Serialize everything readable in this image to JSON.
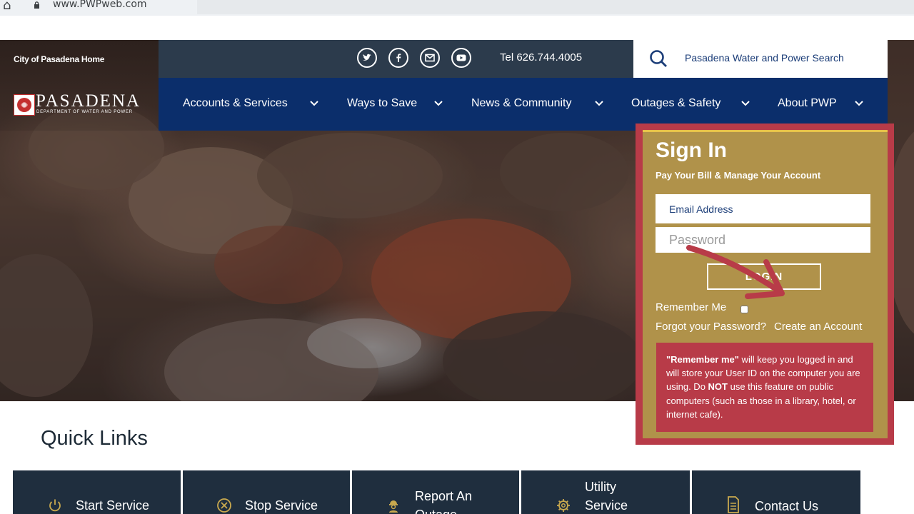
{
  "browser": {
    "url": "www.PWPweb.com",
    "icons": [
      "home-icon",
      "lock-icon"
    ]
  },
  "header": {
    "city_home": "City of Pasadena Home",
    "logo_name": "PASADENA",
    "logo_sub": "DEPARTMENT OF WATER AND POWER",
    "social_icons": [
      "twitter-icon",
      "facebook-icon",
      "email-icon",
      "youtube-icon"
    ],
    "tel": "Tel 626.744.4005",
    "search_label": "Pasadena Water and Power Search"
  },
  "nav": {
    "items": [
      {
        "label": "Accounts & Services"
      },
      {
        "label": "Ways to Save"
      },
      {
        "label": "News & Community"
      },
      {
        "label": "Outages & Safety"
      },
      {
        "label": "About PWP"
      }
    ]
  },
  "signin": {
    "title": "Sign In",
    "subtitle": "Pay Your Bill & Manage Your Account",
    "email_placeholder": "Email Address",
    "password_placeholder": "Password",
    "login_label": "LOGIN",
    "remember_label": "Remember Me",
    "forgot_label": "Forgot your Password?",
    "create_label": "Create an Account",
    "notice": {
      "lead": "\"Remember me\"",
      "part1": " will keep you logged in and will store your User ID on the computer you are using. Do ",
      "emphasis": "NOT",
      "part2": " use this feature on public computers (such as those in a library, hotel, or internet cafe)."
    }
  },
  "quick_links": {
    "title": "Quick Links",
    "tiles": [
      {
        "label": "Start Service",
        "icon": "power-icon"
      },
      {
        "label": "Stop Service",
        "icon": "close-circle-icon"
      },
      {
        "label": "Report An Outage",
        "icon": "worker-icon"
      },
      {
        "label": "Utility Service",
        "icon": "gear-icon"
      },
      {
        "label": "Contact Us",
        "icon": "document-icon"
      }
    ]
  },
  "colors": {
    "nav_blue": "#0b2e6b",
    "topbar_slate": "#2c3b4c",
    "signin_gold": "#b0924a",
    "signin_red": "#b83b48",
    "tile_navy": "#1f2e3e"
  }
}
